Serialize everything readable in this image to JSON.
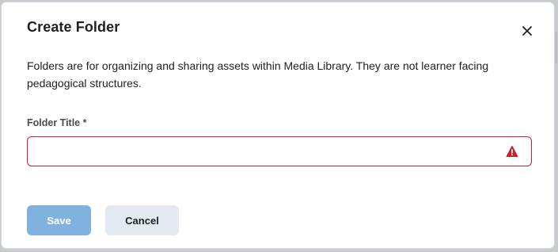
{
  "dialog": {
    "title": "Create Folder",
    "close_label": "×",
    "description": "Folders are for organizing and sharing assets within Media Library. They are not learner facing pedagogical structures.",
    "field": {
      "label": "Folder Title *",
      "value": "",
      "placeholder": "",
      "status": "error"
    },
    "buttons": {
      "save_label": "Save",
      "cancel_label": "Cancel"
    }
  },
  "colors": {
    "error": "#cd2026",
    "primary_disabled": "#7fb2df",
    "secondary_bg": "#e3e9f1",
    "text": "#202122"
  },
  "icons": {
    "close": "close-icon",
    "warning": "warning-triangle-icon"
  }
}
